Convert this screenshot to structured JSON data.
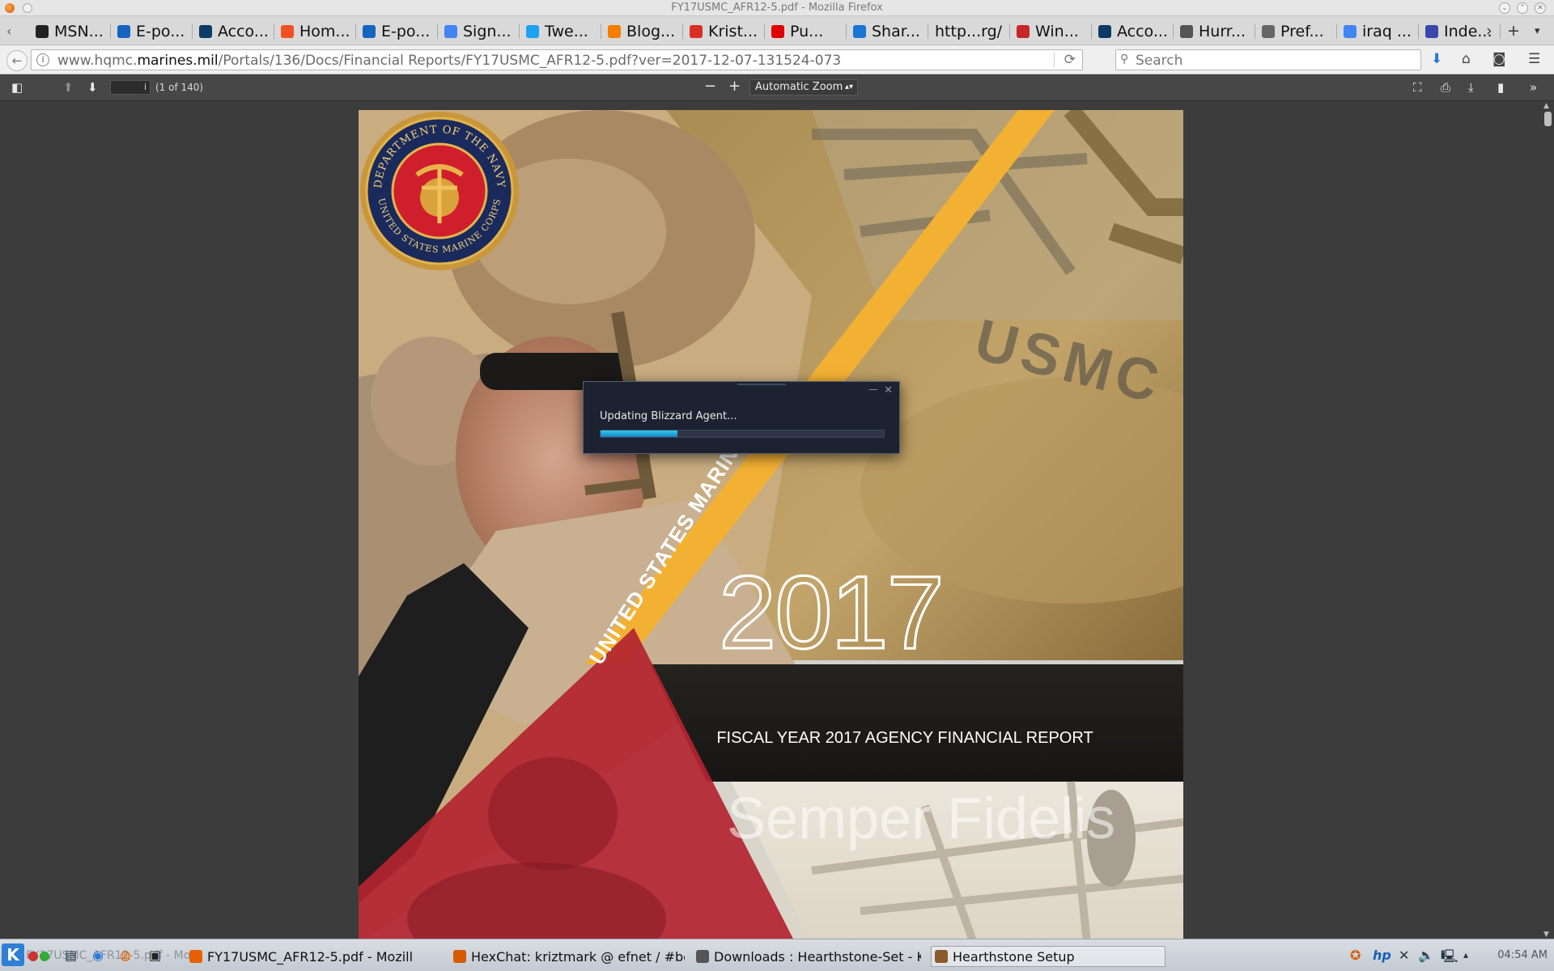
{
  "window": {
    "title": "FY17USMC_AFR12-5.pdf - Mozilla Firefox"
  },
  "tabs": [
    {
      "label": "MSN...",
      "icon": "msn-icon",
      "color": "#222222"
    },
    {
      "label": "E-po...",
      "icon": "outlook-icon",
      "color": "#1565c0"
    },
    {
      "label": "Acco...",
      "icon": "account-icon",
      "color": "#0d3b66"
    },
    {
      "label": "Hom...",
      "icon": "microsoft-icon",
      "color": "#f25022"
    },
    {
      "label": "E-po...",
      "icon": "outlook-icon",
      "color": "#1565c0"
    },
    {
      "label": "Sign...",
      "icon": "google-icon",
      "color": "#4285f4"
    },
    {
      "label": "Twe...",
      "icon": "twitter-icon",
      "color": "#1da1f2"
    },
    {
      "label": "Blog...",
      "icon": "blogger-icon",
      "color": "#f57d00"
    },
    {
      "label": "Krist...",
      "icon": "gmail-icon",
      "color": "#d93025"
    },
    {
      "label": "Pu...",
      "icon": "youtube-icon",
      "color": "#e00000"
    },
    {
      "label": "Shar...",
      "icon": "sharepoint-icon",
      "color": "#1976d2"
    },
    {
      "label": "http...rg/",
      "icon": "",
      "color": ""
    },
    {
      "label": "Win...",
      "icon": "pdf-icon",
      "color": "#c62828"
    },
    {
      "label": "Acco...",
      "icon": "account-icon",
      "color": "#0d3b66"
    },
    {
      "label": "Hurr...",
      "icon": "hurricane-icon",
      "color": "#555555"
    },
    {
      "label": "Pref...",
      "icon": "gear-icon",
      "color": "#666666"
    },
    {
      "label": "iraq ...",
      "icon": "google-icon",
      "color": "#4285f4"
    },
    {
      "label": "Inde...",
      "icon": "index-icon",
      "color": "#3949ab"
    }
  ],
  "address": {
    "prefix": "www.hqmc.",
    "domain": "marines.mil",
    "path": "/Portals/136/Docs/Financial Reports/FY17USMC_AFR12-5.pdf?ver=2017-12-07-131524-073"
  },
  "search": {
    "placeholder": "Search"
  },
  "pdf": {
    "page_input": "i",
    "page_count": "(1 of 140)",
    "zoom": "Automatic Zoom",
    "zoom_out": "−",
    "zoom_in": "+"
  },
  "document": {
    "banner": "UNITED STATES MARINE C",
    "year": "2017",
    "report_title": "FISCAL YEAR 2017 AGENCY FINANCIAL REPORT",
    "motto": "Semper Fidelis",
    "stencil": "USMC",
    "seal_top": "DEPARTMENT OF THE NAVY",
    "seal_bottom": "UNITED STATES MARINE CORPS"
  },
  "dialog": {
    "message": "Updating Blizzard Agent...",
    "progress": 0.27,
    "accent": "#1fa7e0"
  },
  "taskbar": {
    "ghost_text": "FY17USMC_AFR12-5.pdf - Mozi",
    "tasks": [
      {
        "label": "FY17USMC_AFR12-5.pdf - Mozill",
        "icon": "firefox-icon",
        "color": "#e66000"
      },
      {
        "label": "HexChat: kriztmark @ efnet / #bet",
        "icon": "hexchat-icon",
        "color": "#d65a00"
      },
      {
        "label": "Downloads : Hearthstone-Set - K",
        "icon": "folder-icon",
        "color": "#555555"
      },
      {
        "label": "Hearthstone Setup",
        "icon": "hearthstone-icon",
        "color": "#8b5a2b"
      }
    ],
    "clock": "04:54 AM"
  }
}
